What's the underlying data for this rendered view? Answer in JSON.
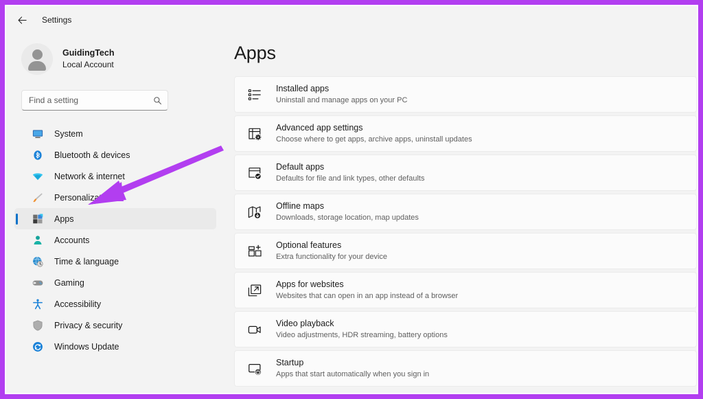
{
  "window": {
    "titlebar_title": "Settings",
    "back_icon": "back-arrow-icon",
    "annotation_color": "#b23ef0"
  },
  "sidebar": {
    "account": {
      "name": "GuidingTech",
      "type": "Local Account",
      "avatar_icon": "person-avatar-icon"
    },
    "search": {
      "placeholder": "Find a setting",
      "value": "",
      "icon": "search-icon"
    },
    "items": [
      {
        "label": "System",
        "icon": "system-monitor-icon",
        "selected": false
      },
      {
        "label": "Bluetooth & devices",
        "icon": "bluetooth-icon",
        "selected": false
      },
      {
        "label": "Network & internet",
        "icon": "wifi-icon",
        "selected": false
      },
      {
        "label": "Personalization",
        "icon": "paintbrush-icon",
        "selected": false
      },
      {
        "label": "Apps",
        "icon": "apps-grid-icon",
        "selected": true
      },
      {
        "label": "Accounts",
        "icon": "account-person-icon",
        "selected": false
      },
      {
        "label": "Time & language",
        "icon": "globe-clock-icon",
        "selected": false
      },
      {
        "label": "Gaming",
        "icon": "gamepad-icon",
        "selected": false
      },
      {
        "label": "Accessibility",
        "icon": "accessibility-person-icon",
        "selected": false
      },
      {
        "label": "Privacy & security",
        "icon": "shield-icon",
        "selected": false
      },
      {
        "label": "Windows Update",
        "icon": "update-refresh-icon",
        "selected": false
      }
    ]
  },
  "main": {
    "title": "Apps",
    "cards": [
      {
        "title": "Installed apps",
        "subtitle": "Uninstall and manage apps on your PC",
        "icon": "list-apps-icon"
      },
      {
        "title": "Advanced app settings",
        "subtitle": "Choose where to get apps, archive apps, uninstall updates",
        "icon": "window-gear-icon"
      },
      {
        "title": "Default apps",
        "subtitle": "Defaults for file and link types, other defaults",
        "icon": "window-check-icon"
      },
      {
        "title": "Offline maps",
        "subtitle": "Downloads, storage location, map updates",
        "icon": "map-download-icon"
      },
      {
        "title": "Optional features",
        "subtitle": "Extra functionality for your device",
        "icon": "grid-plus-icon"
      },
      {
        "title": "Apps for websites",
        "subtitle": "Websites that can open in an app instead of a browser",
        "icon": "window-external-link-icon"
      },
      {
        "title": "Video playback",
        "subtitle": "Video adjustments, HDR streaming, battery options",
        "icon": "video-camera-icon"
      },
      {
        "title": "Startup",
        "subtitle": "Apps that start automatically when you sign in",
        "icon": "startup-power-icon"
      }
    ]
  }
}
